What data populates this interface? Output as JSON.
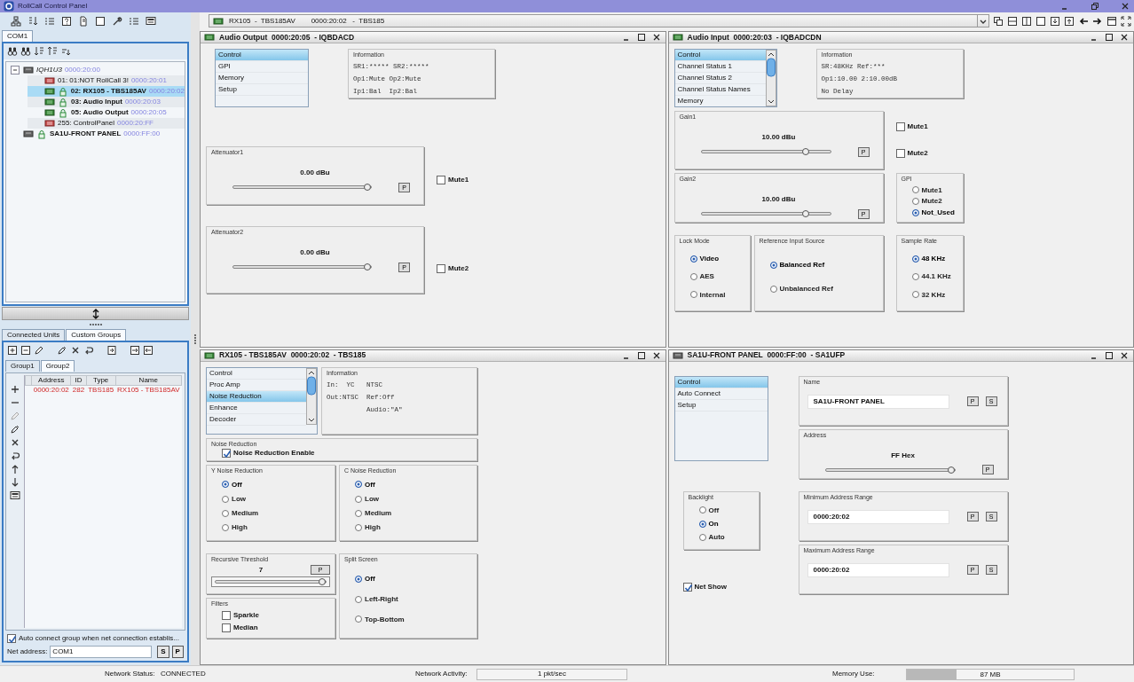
{
  "window": {
    "title": "RollCall Control Panel"
  },
  "left_panel": {
    "tabs": [
      {
        "label": "COM1",
        "selected": true
      }
    ],
    "tree": [
      {
        "label": "IQH1U3",
        "address": "0000:20:00",
        "kind": "unit",
        "expanded": true,
        "selected": false,
        "children": [
          {
            "label": "01: 01:NOT RollCall 3!",
            "address": "0000:20:01",
            "kind": "offline",
            "selected": false
          },
          {
            "label": "02: RX105 - TBS185AV",
            "address": "0000:20:02",
            "kind": "online",
            "selected": true
          },
          {
            "label": "03: Audio Input",
            "address": "0000:20:03",
            "kind": "online",
            "selected": false
          },
          {
            "label": "05: Audio Output",
            "address": "0000:20:05",
            "kind": "online",
            "selected": false
          },
          {
            "label": "255: ControlPanel",
            "address": "0000:20:FF",
            "kind": "offline",
            "selected": false
          }
        ]
      },
      {
        "label": "SA1U-FRONT PANEL",
        "address": "0000:FF:00",
        "kind": "panel",
        "selected": false
      }
    ],
    "bottom_tabs": [
      {
        "label": "Connected Units",
        "selected": false
      },
      {
        "label": "Custom Groups",
        "selected": true
      }
    ],
    "group_tabs": [
      {
        "label": "Group1",
        "selected": false
      },
      {
        "label": "Group2",
        "selected": true
      }
    ],
    "group_table": {
      "columns": [
        "Address",
        "ID",
        "Type",
        "Name"
      ],
      "rows": [
        [
          "0000:20:02",
          "282",
          "TBS185",
          "RX105 - TBS185AV"
        ]
      ]
    },
    "auto_connect": {
      "label": "Auto connect group when net connection establis...",
      "checked": true
    },
    "net_address": {
      "label": "Net address:",
      "value": "COM1"
    },
    "net_buttons": [
      "S",
      "P"
    ]
  },
  "device_bar": {
    "value": "RX105  -  TBS185AV        0000:20:02   -  TBS185"
  },
  "panels": [
    {
      "title": "Audio Output  0000:20:05  - IQBDACD",
      "kind": "card",
      "sections": [
        {
          "kind": "menu",
          "items": [
            {
              "label": "Control",
              "selected": true
            },
            {
              "label": "GPI",
              "selected": false
            },
            {
              "label": "Memory",
              "selected": false
            },
            {
              "label": "Setup",
              "selected": false
            }
          ]
        },
        {
          "kind": "info",
          "title": "Information",
          "lines": [
            "SR1:***** SR2:*****",
            "Op1:Mute Op2:Mute",
            "Ip1:Bal  Ip2:Bal"
          ]
        },
        {
          "kind": "slider",
          "title": "Attenuator1",
          "reading": "0.00 dBu",
          "level": 1,
          "button": "P"
        },
        {
          "kind": "checkbox",
          "label": "Mute1",
          "checked": false
        },
        {
          "kind": "slider",
          "title": "Attenuator2",
          "reading": "0.00 dBu",
          "level": 1,
          "button": "P"
        },
        {
          "kind": "checkbox",
          "label": "Mute2",
          "checked": false
        }
      ]
    },
    {
      "title": "Audio Input  0000:20:03  - IQBADCDN",
      "kind": "card",
      "sections": [
        {
          "kind": "menu",
          "items": [
            {
              "label": "Control",
              "selected": true
            },
            {
              "label": "Channel Status 1",
              "selected": false
            },
            {
              "label": "Channel Status 2",
              "selected": false
            },
            {
              "label": "Channel Status Names",
              "selected": false
            },
            {
              "label": "Memory",
              "selected": false
            }
          ]
        },
        {
          "kind": "info",
          "title": "Information",
          "lines": [
            "SR:48KHz Ref:***",
            "Op1:10.00 2:10.00dB",
            "No Delay"
          ]
        },
        {
          "kind": "slider",
          "title": "Gain1",
          "reading": "10.00 dBu",
          "level": 0.83,
          "button": "P"
        },
        {
          "kind": "checkbox",
          "label": "Mute1",
          "checked": false
        },
        {
          "kind": "checkbox",
          "label": "Mute2",
          "checked": false
        },
        {
          "kind": "slider",
          "title": "Gain2",
          "reading": "10.00 dBu",
          "level": 0.83,
          "button": "P"
        },
        {
          "kind": "radios",
          "title": "GPI",
          "items": [
            {
              "label": "Mute1",
              "selected": false
            },
            {
              "label": "Mute2",
              "selected": false
            },
            {
              "label": "Not_Used",
              "selected": true
            }
          ]
        },
        {
          "kind": "radios",
          "title": "Lock Mode",
          "items": [
            {
              "label": "Video",
              "selected": true
            },
            {
              "label": "AES",
              "selected": false
            },
            {
              "label": "Internal",
              "selected": false
            }
          ]
        },
        {
          "kind": "radios",
          "title": "Reference Input Source",
          "items": [
            {
              "label": "Balanced Ref",
              "selected": true
            },
            {
              "label": "Unbalanced Ref",
              "selected": false
            }
          ]
        },
        {
          "kind": "radios",
          "title": "Sample Rate",
          "items": [
            {
              "label": "48 KHz",
              "selected": true
            },
            {
              "label": "44.1 KHz",
              "selected": false
            },
            {
              "label": "32 KHz",
              "selected": false
            }
          ]
        }
      ]
    },
    {
      "title": "RX105 - TBS185AV  0000:20:02  - TBS185",
      "kind": "card",
      "sections": [
        {
          "kind": "menu",
          "items": [
            {
              "label": "Control",
              "selected": false
            },
            {
              "label": "Proc Amp",
              "selected": false
            },
            {
              "label": "Noise Reduction",
              "selected": true
            },
            {
              "label": "Enhance",
              "selected": false
            },
            {
              "label": "Decoder",
              "selected": false
            }
          ]
        },
        {
          "kind": "info",
          "title": "Information",
          "lines": [
            "In:  YC   NTSC",
            "Out:NTSC  Ref:Off",
            "          Audio:\"A\""
          ]
        },
        {
          "kind": "check_group",
          "title": "Noise Reduction",
          "items": [
            {
              "label": "Noise Reduction Enable",
              "checked": true
            }
          ]
        },
        {
          "kind": "radios",
          "title": "Y Noise Reduction",
          "items": [
            {
              "label": "Off",
              "selected": true
            },
            {
              "label": "Low",
              "selected": false
            },
            {
              "label": "Medium",
              "selected": false
            },
            {
              "label": "High",
              "selected": false
            }
          ]
        },
        {
          "kind": "radios",
          "title": "C Noise Reduction",
          "items": [
            {
              "label": "Off",
              "selected": true
            },
            {
              "label": "Low",
              "selected": false
            },
            {
              "label": "Medium",
              "selected": false
            },
            {
              "label": "High",
              "selected": false
            }
          ]
        },
        {
          "kind": "threshold",
          "title": "Recursive Threshold",
          "reading": "7",
          "button": "P",
          "level": 1
        },
        {
          "kind": "check_group",
          "title": "Filters",
          "items": [
            {
              "label": "Sparkle",
              "checked": false
            },
            {
              "label": "Median",
              "checked": false
            }
          ]
        },
        {
          "kind": "radios",
          "title": "Split Screen",
          "items": [
            {
              "label": "Off",
              "selected": true
            },
            {
              "label": "Left-Right",
              "selected": false
            },
            {
              "label": "Top-Bottom",
              "selected": false
            }
          ]
        }
      ]
    },
    {
      "title": "SA1U-FRONT PANEL  0000:FF:00  - SA1UFP",
      "kind": "panel",
      "sections": [
        {
          "kind": "menu",
          "items": [
            {
              "label": "Control",
              "selected": true
            },
            {
              "label": "Auto Connect",
              "selected": false
            },
            {
              "label": "Setup",
              "selected": false
            }
          ]
        },
        {
          "kind": "field",
          "title": "Name",
          "value": "SA1U-FRONT PANEL",
          "buttons": [
            "P",
            "S"
          ]
        },
        {
          "kind": "slider",
          "title": "Address",
          "reading": "FF Hex",
          "level": 1,
          "button": "P"
        },
        {
          "kind": "radios",
          "title": "Backlight",
          "items": [
            {
              "label": "Off",
              "selected": false
            },
            {
              "label": "On",
              "selected": true
            },
            {
              "label": "Auto",
              "selected": false
            }
          ]
        },
        {
          "kind": "field",
          "title": "Minimum Address Range",
          "value": "0000:20:02",
          "buttons": [
            "P",
            "S"
          ]
        },
        {
          "kind": "checkbox",
          "label": "Net Show",
          "checked": true
        },
        {
          "kind": "field",
          "title": "Maximum Address Range",
          "value": "0000:20:02",
          "buttons": [
            "P",
            "S"
          ]
        }
      ]
    }
  ],
  "status_bar": {
    "network_status": {
      "label": "Network Status:",
      "value": "CONNECTED"
    },
    "network_activity": {
      "label": "Network Activity:",
      "value": "1 pkt/sec"
    },
    "memory_use": {
      "label": "Memory Use:",
      "value": "87 MB",
      "level": 0.3
    }
  }
}
